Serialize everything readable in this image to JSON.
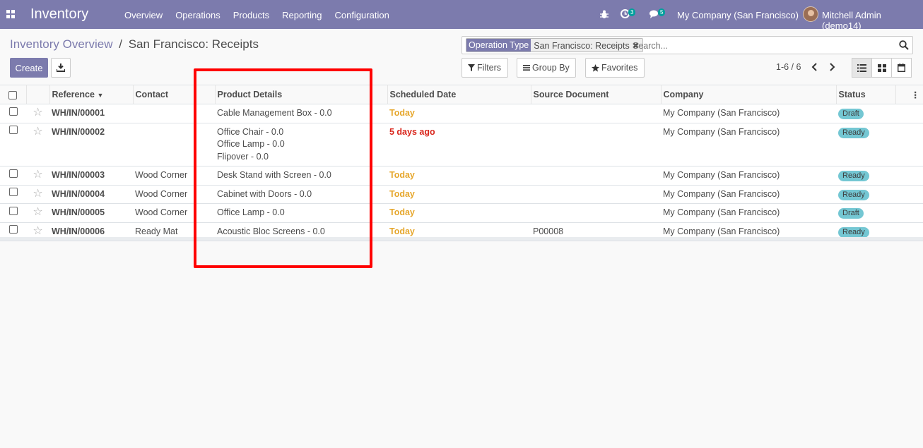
{
  "nav": {
    "brand": "Inventory",
    "menu": [
      "Overview",
      "Operations",
      "Products",
      "Reporting",
      "Configuration"
    ],
    "activity_count": "3",
    "message_count": "5",
    "company": "My Company (San Francisco)",
    "user": "Mitchell Admin (demo14)"
  },
  "breadcrumb": {
    "parent": "Inventory Overview",
    "separator": "/",
    "current": "San Francisco: Receipts"
  },
  "actions": {
    "create_label": "Create"
  },
  "search": {
    "facet_type": "Operation Type",
    "facet_value": "San Francisco: Receipts",
    "placeholder": "Search..."
  },
  "filters": {
    "filters_label": "Filters",
    "groupby_label": "Group By",
    "favorites_label": "Favorites"
  },
  "pager": {
    "range": "1-6 / 6"
  },
  "table": {
    "columns": [
      "Reference",
      "Contact",
      "Product Details",
      "Scheduled Date",
      "Source Document",
      "Company",
      "Status"
    ],
    "rows": [
      {
        "reference": "WH/IN/00001",
        "contact": "",
        "products": [
          "Cable Management Box - 0.0"
        ],
        "date": "Today",
        "date_state": "today",
        "source": "",
        "company": "My Company (San Francisco)",
        "status": "Draft"
      },
      {
        "reference": "WH/IN/00002",
        "contact": "",
        "products": [
          "Office Chair - 0.0",
          "Office Lamp - 0.0",
          "Flipover - 0.0"
        ],
        "date": "5 days ago",
        "date_state": "late",
        "source": "",
        "company": "My Company (San Francisco)",
        "status": "Ready"
      },
      {
        "reference": "WH/IN/00003",
        "contact": "Wood Corner",
        "products": [
          "Desk Stand with Screen - 0.0"
        ],
        "date": "Today",
        "date_state": "today",
        "source": "",
        "company": "My Company (San Francisco)",
        "status": "Ready"
      },
      {
        "reference": "WH/IN/00004",
        "contact": "Wood Corner",
        "products": [
          "Cabinet with Doors - 0.0"
        ],
        "date": "Today",
        "date_state": "today",
        "source": "",
        "company": "My Company (San Francisco)",
        "status": "Ready"
      },
      {
        "reference": "WH/IN/00005",
        "contact": "Wood Corner",
        "products": [
          "Office Lamp - 0.0"
        ],
        "date": "Today",
        "date_state": "today",
        "source": "",
        "company": "My Company (San Francisco)",
        "status": "Draft"
      },
      {
        "reference": "WH/IN/00006",
        "contact": "Ready Mat",
        "products": [
          "Acoustic Bloc Screens - 0.0"
        ],
        "date": "Today",
        "date_state": "today",
        "source": "P00008",
        "company": "My Company (San Francisco)",
        "status": "Ready"
      }
    ]
  },
  "colors": {
    "brand": "#7c7bad",
    "status_badge": "#74c7d3",
    "today": "#e6a72d",
    "late": "#d9261c",
    "highlight": "#ff0000"
  }
}
